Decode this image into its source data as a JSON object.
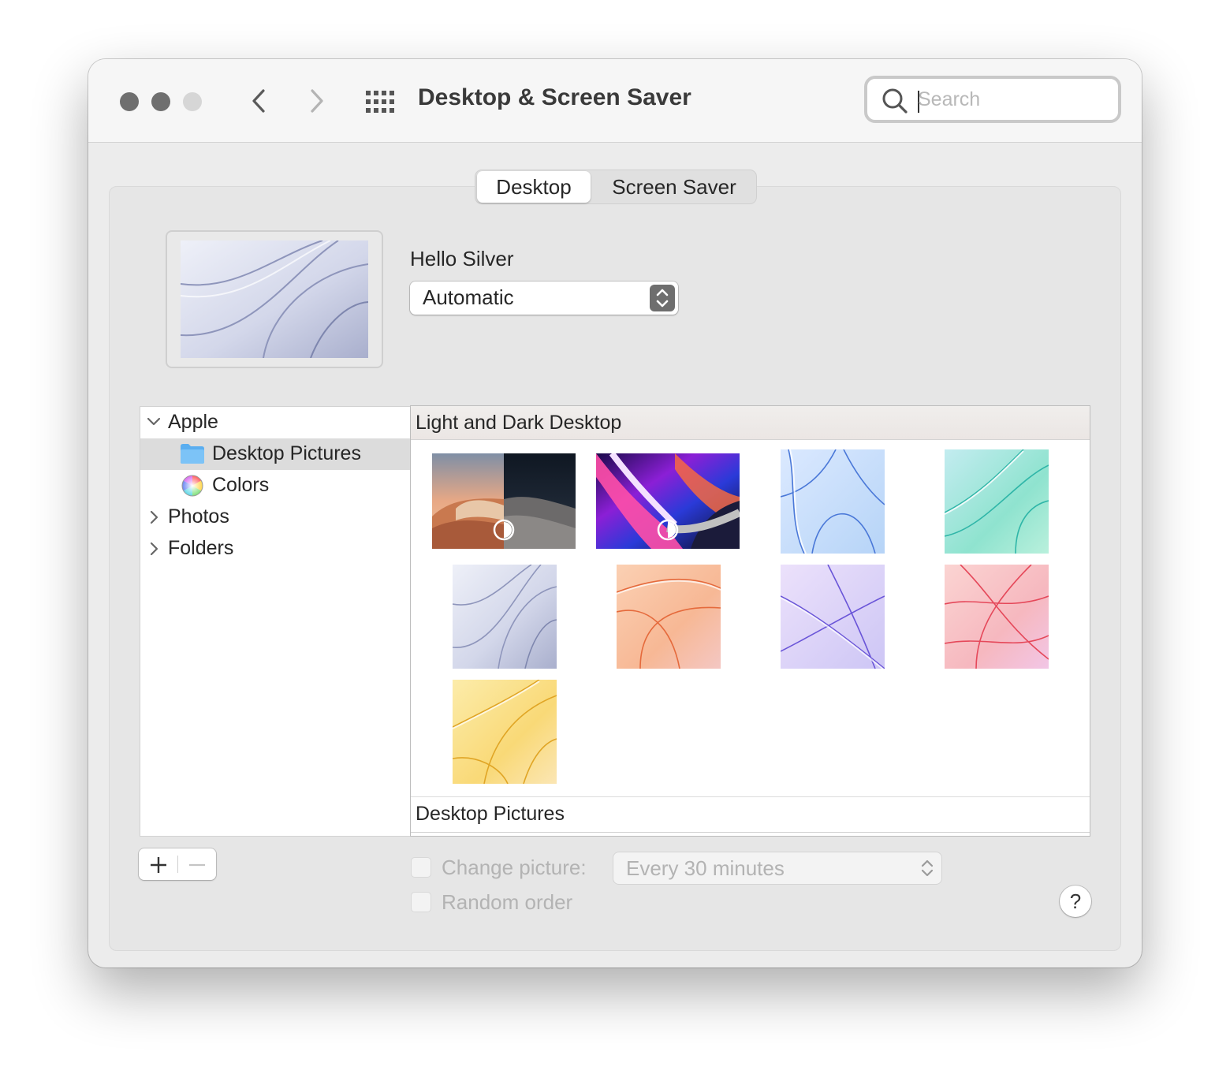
{
  "window": {
    "title": "Desktop & Screen Saver",
    "search_placeholder": "Search",
    "traffic_lights": [
      "#6f6f6f",
      "#6f6f6f",
      "#d6d6d6"
    ]
  },
  "tabs": [
    {
      "label": "Desktop",
      "selected": true
    },
    {
      "label": "Screen Saver",
      "selected": false
    }
  ],
  "current_wallpaper": {
    "name": "Hello Silver",
    "mode": "Automatic"
  },
  "sidebar": {
    "items": [
      {
        "label": "Apple",
        "expanded": true
      },
      {
        "label": "Desktop Pictures",
        "selected": true
      },
      {
        "label": "Colors"
      },
      {
        "label": "Photos",
        "expanded": false
      },
      {
        "label": "Folders",
        "expanded": false
      }
    ]
  },
  "content": {
    "section1": "Light and Dark Desktop",
    "section2": "Desktop Pictures"
  },
  "options": {
    "change_picture_label": "Change picture:",
    "change_picture_checked": false,
    "interval": "Every 30 minutes",
    "random_order_label": "Random order",
    "random_order_checked": false
  },
  "buttons": {
    "add": "+",
    "remove": "—",
    "help": "?"
  }
}
